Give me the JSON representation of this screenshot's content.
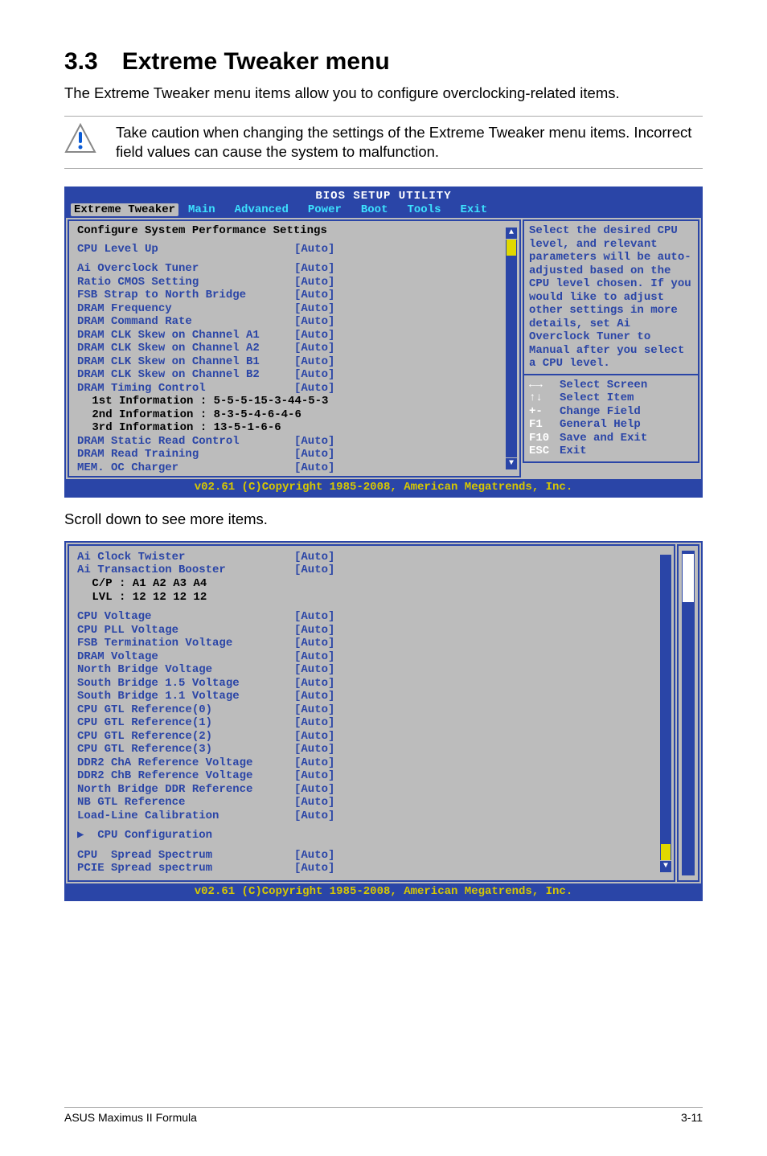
{
  "heading": {
    "num": "3.3",
    "title": "Extreme Tweaker menu"
  },
  "intro": "The Extreme Tweaker menu items allow you to configure overclocking-related items.",
  "caution": "Take caution when changing the settings of the Extreme Tweaker menu items. Incorrect field values can cause the system to malfunction.",
  "bios1": {
    "header": "BIOS SETUP UTILITY",
    "tabs": [
      "Extreme Tweaker",
      "Main",
      "Advanced",
      "Power",
      "Boot",
      "Tools",
      "Exit"
    ],
    "active_tab": 0,
    "section_title": "Configure System Performance Settings",
    "items": [
      {
        "label": "CPU Level Up",
        "value": "[Auto]",
        "blank_after": true
      },
      {
        "label": "Ai Overclock Tuner",
        "value": "[Auto]"
      },
      {
        "label": "Ratio CMOS Setting",
        "value": "[Auto]"
      },
      {
        "label": "FSB Strap to North Bridge",
        "value": "[Auto]"
      },
      {
        "label": "DRAM Frequency",
        "value": "[Auto]"
      },
      {
        "label": "DRAM Command Rate",
        "value": "[Auto]"
      },
      {
        "label": "DRAM CLK Skew on Channel A1",
        "value": "[Auto]"
      },
      {
        "label": "DRAM CLK Skew on Channel A2",
        "value": "[Auto]"
      },
      {
        "label": "DRAM CLK Skew on Channel B1",
        "value": "[Auto]"
      },
      {
        "label": "DRAM CLK Skew on Channel B2",
        "value": "[Auto]"
      },
      {
        "label": "DRAM Timing Control",
        "value": "[Auto]"
      }
    ],
    "info_lines": [
      " 1st Information : 5-5-5-15-3-44-5-3",
      " 2nd Information : 8-3-5-4-6-4-6",
      " 3rd Information : 13-5-1-6-6"
    ],
    "items2": [
      {
        "label": "DRAM Static Read Control",
        "value": "[Auto]"
      },
      {
        "label": "DRAM Read Training",
        "value": "[Auto]"
      },
      {
        "label": "MEM. OC Charger",
        "value": "[Auto]"
      }
    ],
    "help": "Select the desired CPU level, and relevant parameters will be auto-adjusted based on the CPU level chosen. If you would like to adjust other settings in more details, set Ai Overclock Tuner to Manual after you select a CPU level.",
    "keys": [
      {
        "icon": "←→",
        "txt": "Select Screen"
      },
      {
        "icon": "↑↓",
        "txt": "Select Item"
      },
      {
        "icon": "+-",
        "txt": "Change Field"
      },
      {
        "icon": "F1",
        "txt": "General Help"
      },
      {
        "icon": "F10",
        "txt": "Save and Exit"
      },
      {
        "icon": "ESC",
        "txt": "Exit"
      }
    ],
    "footer": "v02.61 (C)Copyright 1985-2008, American Megatrends, Inc."
  },
  "scroll_note": "Scroll down to see more items.",
  "bios2": {
    "items_top": [
      {
        "label": "Ai Clock Twister",
        "value": "[Auto]"
      },
      {
        "label": "Ai Transaction Booster",
        "value": "[Auto]"
      }
    ],
    "sublines": [
      " C/P : A1 A2 A3 A4",
      " LVL : 12 12 12 12"
    ],
    "items_main": [
      {
        "label": "CPU Voltage",
        "value": "[Auto]"
      },
      {
        "label": "CPU PLL Voltage",
        "value": "[Auto]"
      },
      {
        "label": "FSB Termination Voltage",
        "value": "[Auto]"
      },
      {
        "label": "DRAM Voltage",
        "value": "[Auto]"
      },
      {
        "label": "North Bridge Voltage",
        "value": "[Auto]"
      },
      {
        "label": "South Bridge 1.5 Voltage",
        "value": "[Auto]"
      },
      {
        "label": "South Bridge 1.1 Voltage",
        "value": "[Auto]"
      },
      {
        "label": "CPU GTL Reference(0)",
        "value": "[Auto]"
      },
      {
        "label": "CPU GTL Reference(1)",
        "value": "[Auto]"
      },
      {
        "label": "CPU GTL Reference(2)",
        "value": "[Auto]"
      },
      {
        "label": "CPU GTL Reference(3)",
        "value": "[Auto]"
      },
      {
        "label": "DDR2 ChA Reference Voltage",
        "value": "[Auto]"
      },
      {
        "label": "DDR2 ChB Reference Voltage",
        "value": "[Auto]"
      },
      {
        "label": "North Bridge DDR Reference",
        "value": "[Auto]"
      },
      {
        "label": "NB GTL Reference",
        "value": "[Auto]"
      },
      {
        "label": "Load-Line Calibration",
        "value": "[Auto]"
      }
    ],
    "submenu": "CPU Configuration",
    "items_bot": [
      {
        "label": "CPU  Spread Spectrum",
        "value": "[Auto]"
      },
      {
        "label": "PCIE Spread spectrum",
        "value": "[Auto]"
      }
    ],
    "footer": "v02.61 (C)Copyright 1985-2008, American Megatrends, Inc."
  },
  "footer": {
    "left": "ASUS Maximus II Formula",
    "right": "3-11"
  }
}
